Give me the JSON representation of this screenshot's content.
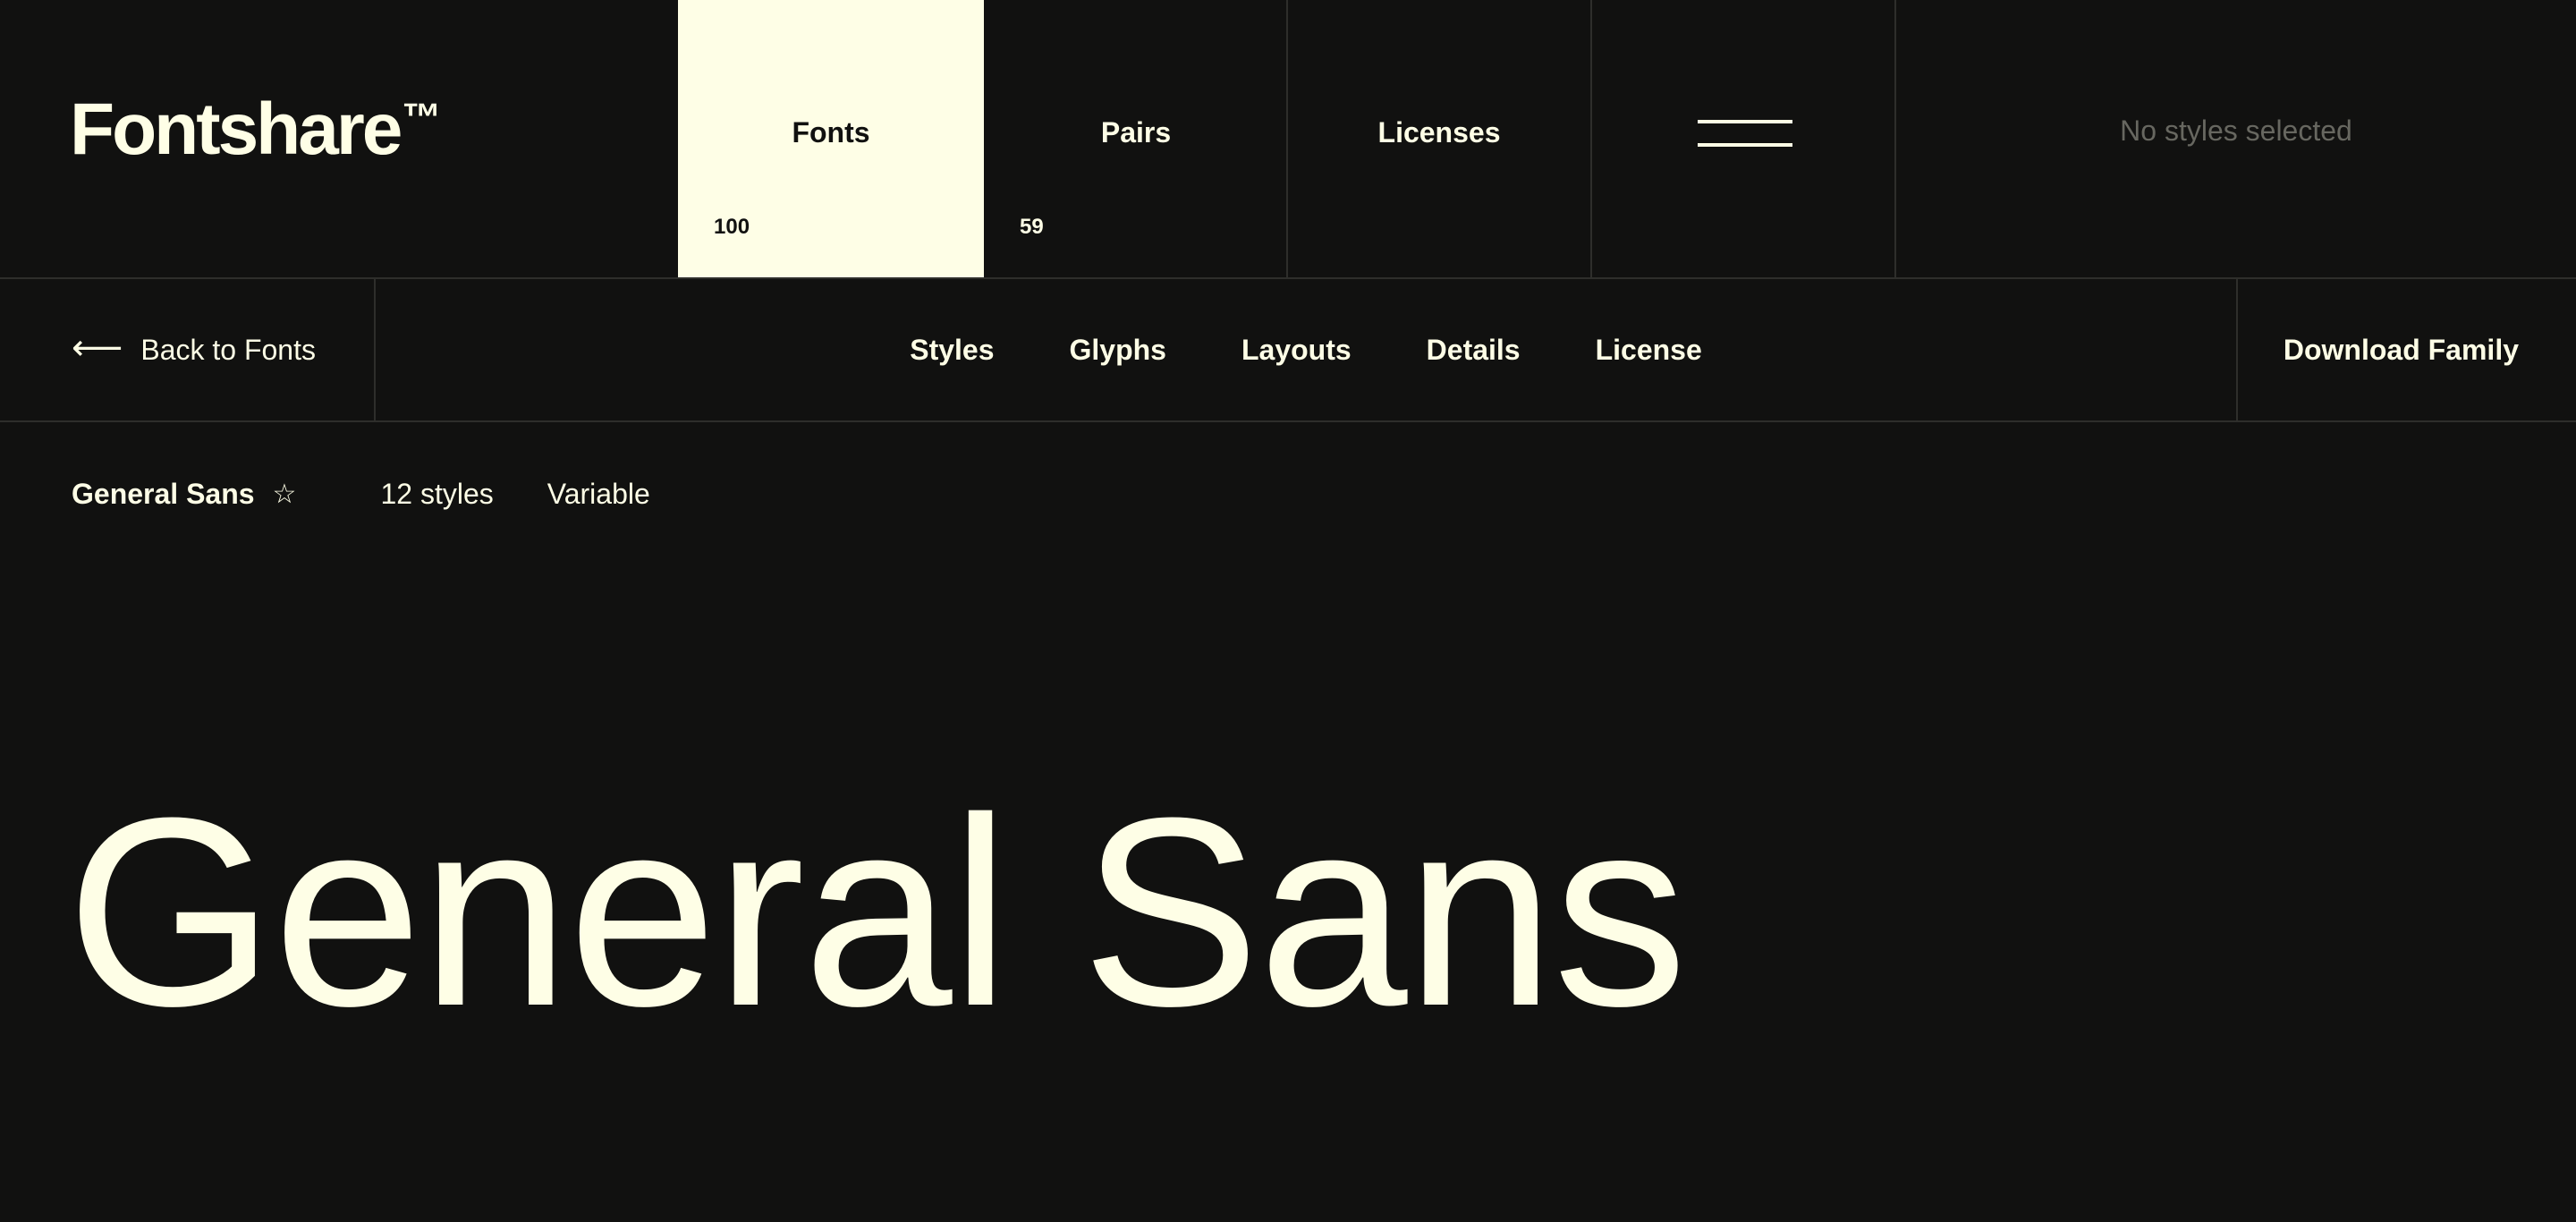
{
  "brand": {
    "name": "Fontshare",
    "mark": "™"
  },
  "nav": {
    "fonts": {
      "label": "Fonts",
      "count": "100"
    },
    "pairs": {
      "label": "Pairs",
      "count": "59"
    },
    "licenses": {
      "label": "Licenses"
    },
    "menu_icon": "hamburger-icon",
    "status": "No styles selected"
  },
  "subnav": {
    "back_label": "Back to Fonts",
    "back_icon": "arrow-left-icon",
    "tabs": [
      "Styles",
      "Glyphs",
      "Layouts",
      "Details",
      "License"
    ],
    "download_label": "Download Family"
  },
  "font": {
    "name": "General Sans",
    "favorite_icon": "star-icon",
    "styles": "12 styles",
    "variable": "Variable",
    "preview": "General Sans"
  },
  "colors": {
    "background": "#111110",
    "foreground": "#fefee6",
    "accent": "#fefee6",
    "muted": "#676760"
  }
}
